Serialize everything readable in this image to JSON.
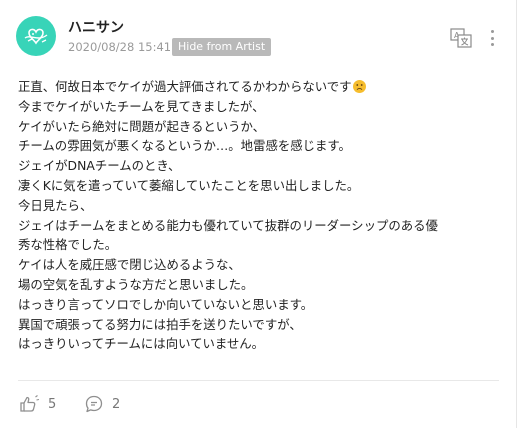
{
  "post": {
    "author": "ハニサン",
    "timestamp": "2020/08/28 15:41",
    "hide_button": "Hide from Artist",
    "icons": {
      "avatar": "avatar-doodle",
      "translate": "translate-icon",
      "more": "vertical-dots-icon",
      "emoji": "worried-face",
      "like": "like-hand-icon",
      "comment": "comment-bubble-icon"
    },
    "colors": {
      "avatar_bg": "#38d4b8",
      "button_bg": "#b9b9b9",
      "emoji": "#f6bd2d"
    },
    "body_lines": [
      "正直、何故日本でケイが過大評価されてるかわからないです",
      "今までケイがいたチームを見てきましたが、",
      "ケイがいたら絶対に問題が起きるというか、",
      "チームの雰囲気が悪くなるというか…。地雷感を感じます。",
      "ジェイがDNAチームのとき、",
      "凄くKに気を遣っていて萎縮していたことを思い出しました。",
      "今日見たら、",
      "ジェイはチームをまとめる能力も優れていて抜群のリーダーシップのある優",
      "秀な性格でした。",
      "ケイは人を威圧感で閉じ込めるような、",
      "場の空気を乱すような方だと思いました。",
      "はっきり言ってソロでしか向いていないと思います。",
      "異国で頑張ってる努力には拍手を送りたいですが、",
      "はっきりいってチームには向いていません。"
    ],
    "like_count": "5",
    "comment_count": "2"
  }
}
